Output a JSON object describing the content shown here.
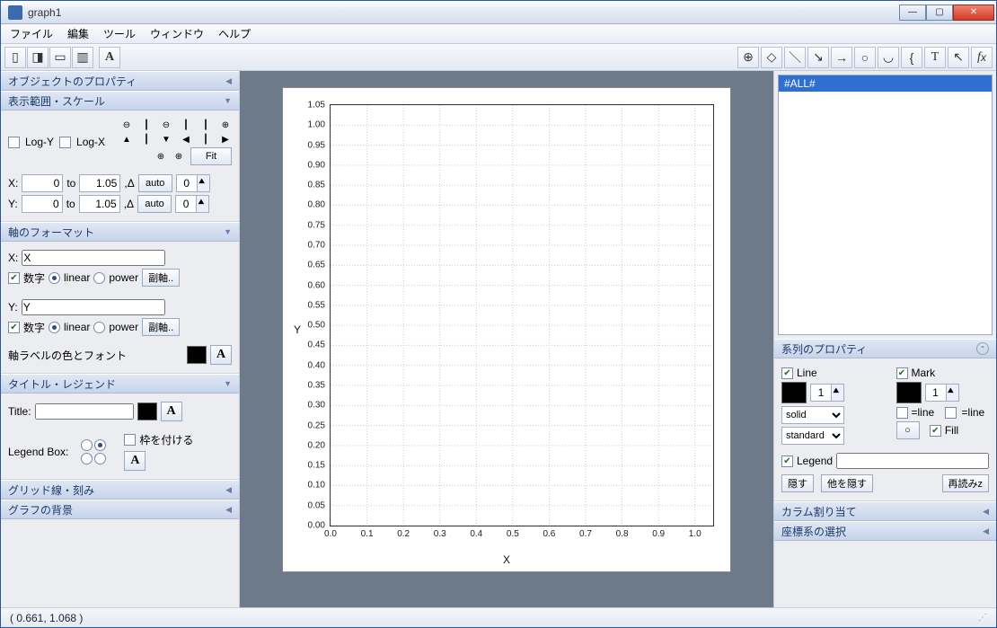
{
  "window": {
    "title": "graph1"
  },
  "menu": {
    "file": "ファイル",
    "edit": "編集",
    "tool": "ツール",
    "window": "ウィンドウ",
    "help": "ヘルプ"
  },
  "left": {
    "objprop": "オブジェクトのプロパティ",
    "range": "表示範囲・スケール",
    "logy": "Log-Y",
    "logx": "Log-X",
    "fit": "Fit",
    "to": "to",
    "auto": "auto",
    "x_from": "0",
    "x_to": "1.05",
    "y_from": "0",
    "y_to": "1.05",
    "zero": "0",
    "axisfmt": "軸のフォーマット",
    "xlabel": "X",
    "ylabel": "Y",
    "numeric": "数字",
    "linear": "linear",
    "power": "power",
    "subaxis": "副軸..",
    "axiscolor": "軸ラベルの色とフォント",
    "titlelegend": "タイトル・レジェンド",
    "title": "Title:",
    "legendbox": "Legend Box:",
    "frame": "枠を付ける",
    "gridtick": "グリッド線・刻み",
    "bg": "グラフの背景"
  },
  "right": {
    "all": "#ALL#",
    "seriesprop": "系列のプロパティ",
    "line": "Line",
    "mark": "Mark",
    "one": "1",
    "solid": "solid",
    "standard": "standard",
    "eqline": "=line",
    "fill": "Fill",
    "legend": "Legend",
    "hide": "隠す",
    "hideother": "他を隠す",
    "reload": "再読みz",
    "colassign": "カラム割り当て",
    "coord": "座標系の選択"
  },
  "status": "( 0.661,  1.068 )",
  "chart_data": {
    "type": "scatter",
    "title": "",
    "xlabel": "X",
    "ylabel": "Y",
    "xlim": [
      0,
      1.05
    ],
    "ylim": [
      0,
      1.05
    ],
    "xticks": [
      0.0,
      0.1,
      0.2,
      0.3,
      0.4,
      0.5,
      0.6,
      0.7,
      0.8,
      0.9,
      1.0
    ],
    "yticks": [
      0.0,
      0.05,
      0.1,
      0.15,
      0.2,
      0.25,
      0.3,
      0.35,
      0.4,
      0.45,
      0.5,
      0.55,
      0.6,
      0.65,
      0.7,
      0.75,
      0.8,
      0.85,
      0.9,
      0.95,
      1.0,
      1.05
    ],
    "series": [],
    "grid": true
  }
}
